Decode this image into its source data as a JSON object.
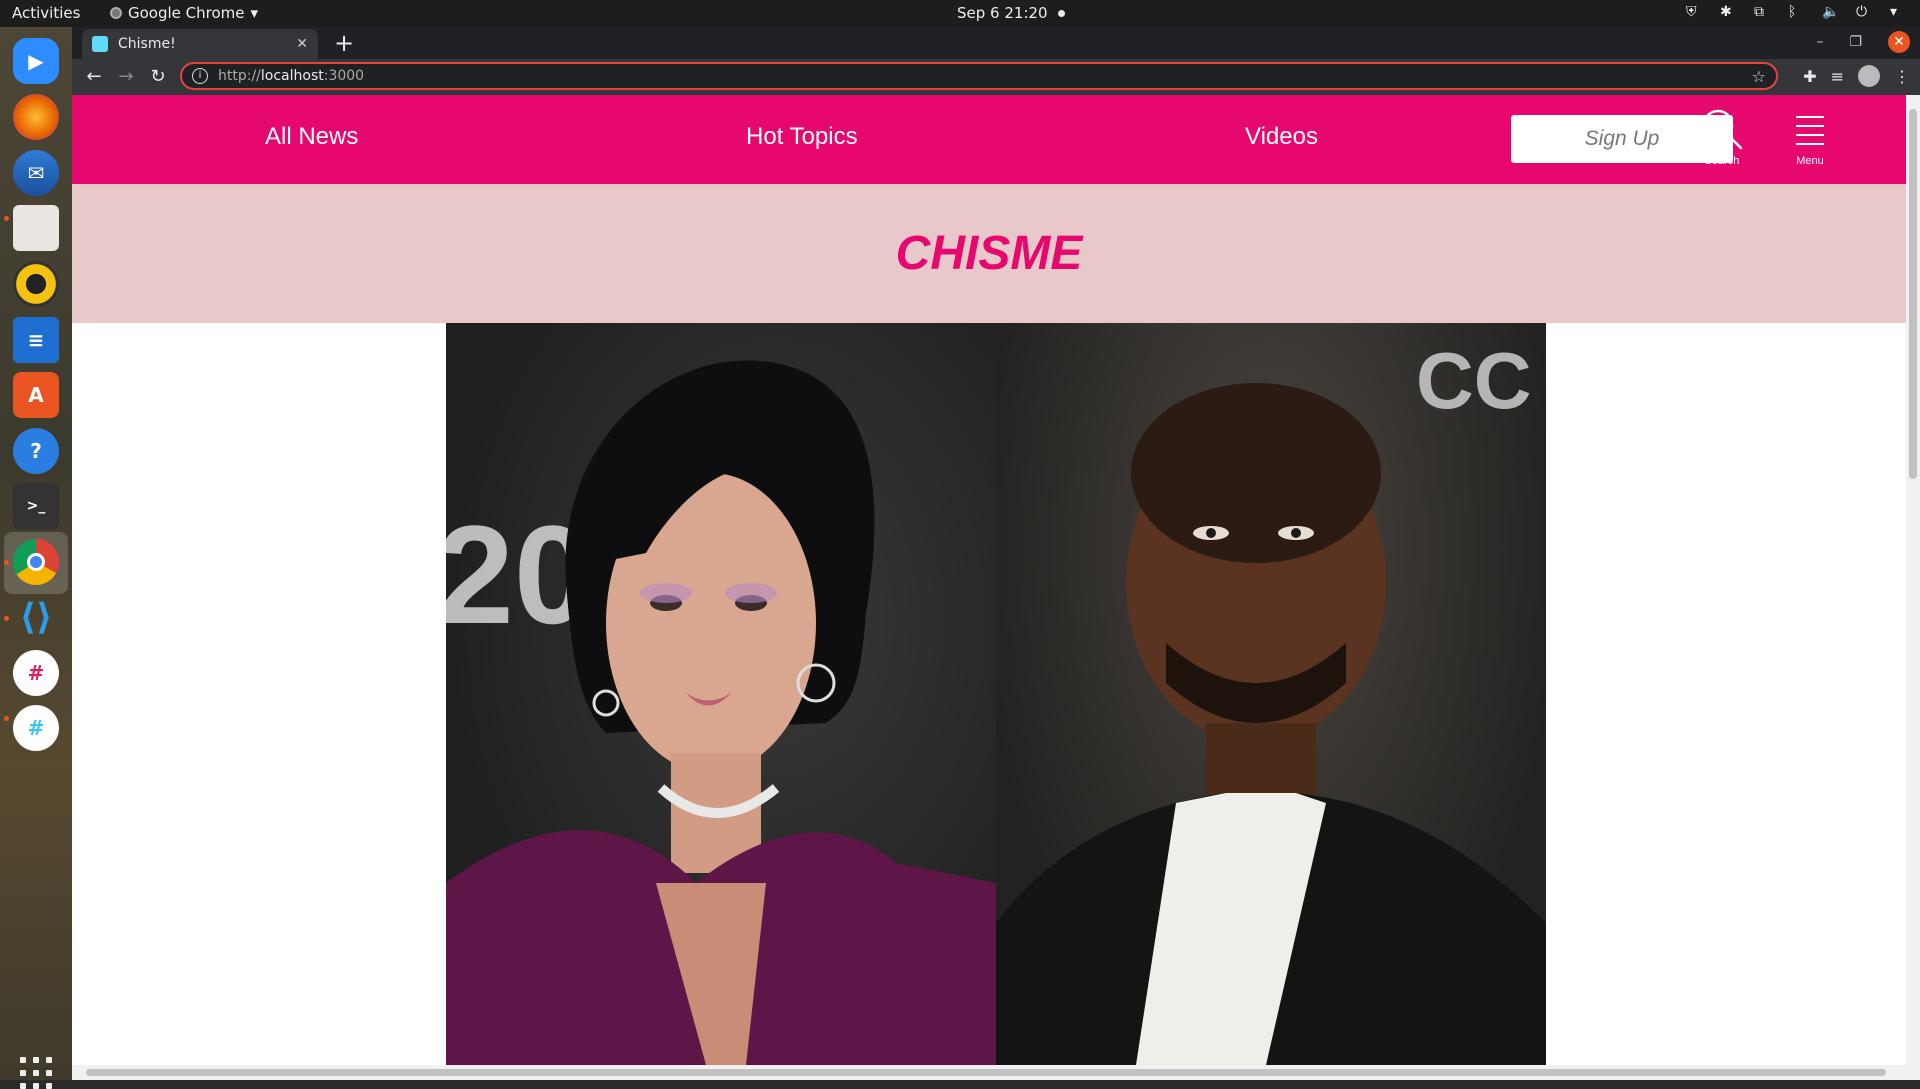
{
  "os": {
    "activities_label": "Activities",
    "app_name": "Google Chrome",
    "clock": "Sep 6  21:20"
  },
  "browser": {
    "tab_title": "Chisme!",
    "url_prefix": "http://",
    "url_host": "localhost",
    "url_port": ":3000"
  },
  "site": {
    "nav": {
      "links": [
        "All News",
        "Hot Topics",
        "Videos"
      ],
      "signup_label": "Sign Up",
      "search_label": "Search",
      "menu_label": "Menu"
    },
    "brand": "CHISME",
    "colors": {
      "primary": "#e6086f",
      "banner": "#e8c8c8"
    }
  }
}
